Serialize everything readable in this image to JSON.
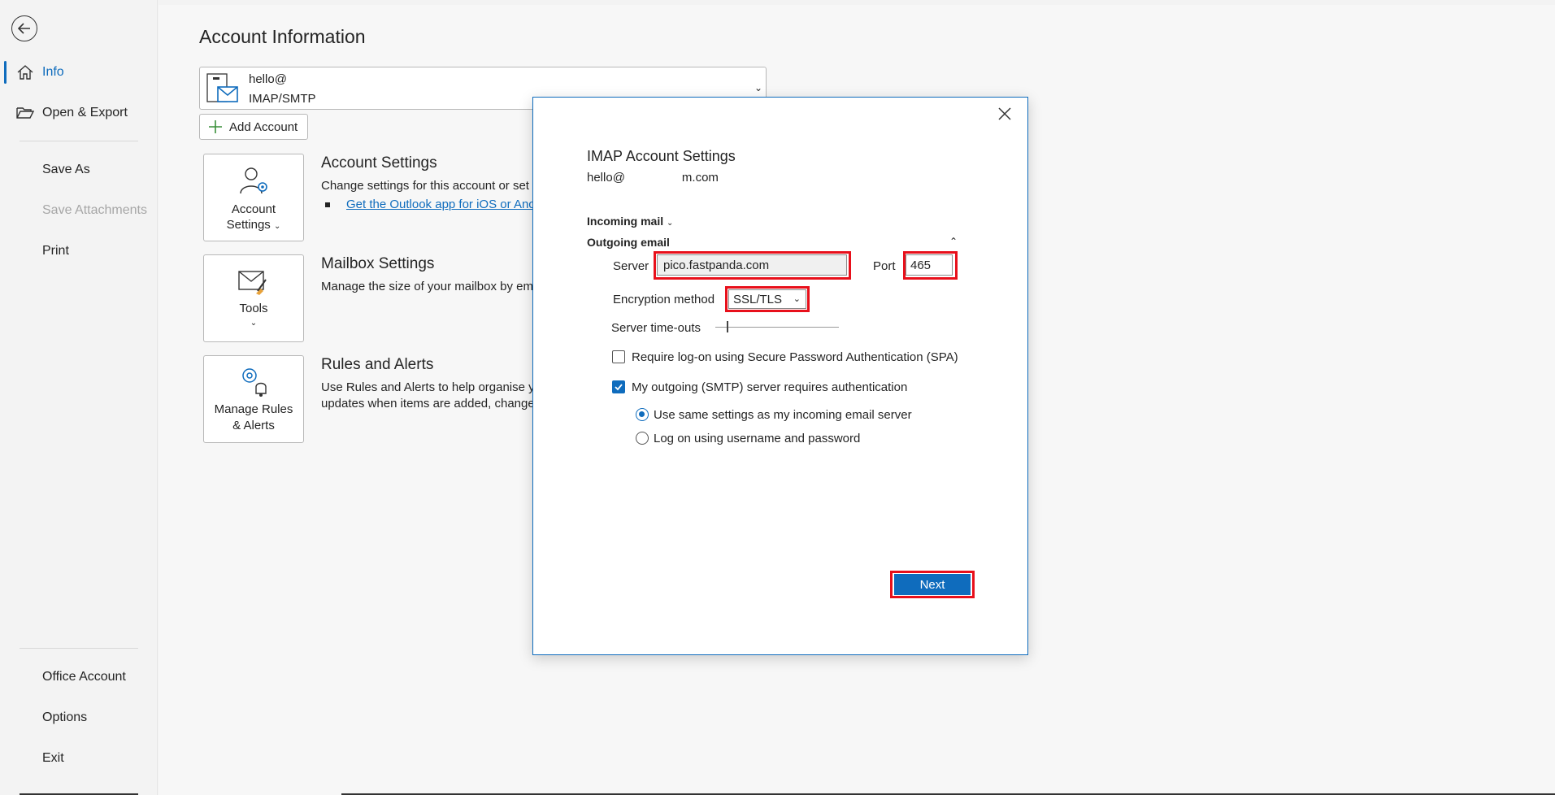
{
  "nav": {
    "items": [
      {
        "label": "Info"
      },
      {
        "label": "Open & Export"
      },
      {
        "label": "Save As"
      },
      {
        "label": "Save Attachments"
      },
      {
        "label": "Print"
      },
      {
        "label": "Office Account"
      },
      {
        "label": "Options"
      },
      {
        "label": "Exit"
      }
    ]
  },
  "main": {
    "title": "Account Information",
    "account": {
      "email": "hello@",
      "type": "IMAP/SMTP"
    },
    "add_account_label": "Add Account",
    "tiles": {
      "account_settings": {
        "line1": "Account",
        "line2": "Settings"
      },
      "tools": {
        "line1": "Tools"
      },
      "rules": {
        "line1": "Manage Rules",
        "line2": "& Alerts"
      }
    },
    "sections": {
      "account_settings": {
        "title": "Account Settings",
        "text": "Change settings for this account or set u",
        "link": "Get the Outlook app for iOS or Anc"
      },
      "mailbox": {
        "title": "Mailbox Settings",
        "text": "Manage the size of your mailbox by em"
      },
      "rules": {
        "title": "Rules and Alerts",
        "text1": "Use Rules and Alerts to help organise yo",
        "text2": "updates when items are added, change"
      }
    }
  },
  "dialog": {
    "title": "IMAP Account Settings",
    "email_prefix": "hello@",
    "email_suffix": "m.com",
    "incoming_label": "Incoming mail",
    "outgoing_label": "Outgoing email",
    "server_label": "Server",
    "server_value": "pico.fastpanda.com",
    "port_label": "Port",
    "port_value": "465",
    "encryption_label": "Encryption method",
    "encryption_value": "SSL/TLS",
    "timeouts_label": "Server time-outs",
    "spa_label": "Require log-on using Secure Password Authentication (SPA)",
    "spa_checked": false,
    "smtp_auth_label": "My outgoing (SMTP) server requires authentication",
    "smtp_auth_checked": true,
    "radio_same_label": "Use same settings as my incoming email server",
    "radio_logon_label": "Log on using username and password",
    "next_label": "Next"
  },
  "colors": {
    "accent": "#0f6cbd",
    "highlight": "#e8101b"
  }
}
